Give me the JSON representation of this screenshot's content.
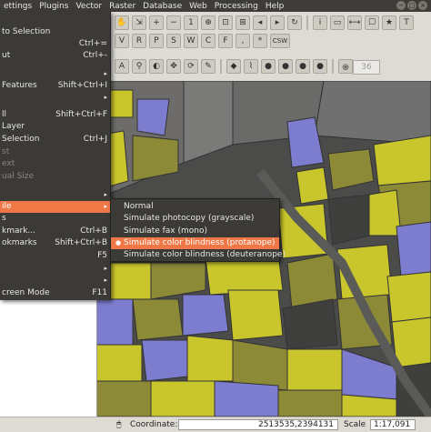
{
  "menubar": [
    "ettings",
    "Plugins",
    "Vector",
    "Raster",
    "Database",
    "Web",
    "Processing",
    "Help"
  ],
  "window_controls": [
    "−",
    "□",
    "×"
  ],
  "main_menu": [
    {
      "label": "to Selection",
      "shortcut": "",
      "state": "normal"
    },
    {
      "label": "",
      "shortcut": "Ctrl+=",
      "state": "normal"
    },
    {
      "label": "ut",
      "shortcut": "Ctrl+-",
      "state": "normal"
    },
    {
      "label": "",
      "shortcut": "▸",
      "state": "normal"
    },
    {
      "label": "Features",
      "shortcut": "Shift+Ctrl+I",
      "state": "normal"
    },
    {
      "label": "",
      "shortcut": "▸",
      "state": "normal"
    },
    {
      "label": "ll",
      "shortcut": "Shift+Ctrl+F",
      "state": "normal"
    },
    {
      "label": "Layer",
      "shortcut": "",
      "state": "normal"
    },
    {
      "label": "Selection",
      "shortcut": "Ctrl+J",
      "state": "normal"
    },
    {
      "label": "st",
      "shortcut": "",
      "state": "disabled"
    },
    {
      "label": "ext",
      "shortcut": "",
      "state": "disabled"
    },
    {
      "label": "ual Size",
      "shortcut": "",
      "state": "disabled"
    },
    {
      "label": "",
      "shortcut": "▸",
      "state": "normal"
    },
    {
      "label": "ile",
      "shortcut": "▸",
      "state": "active"
    },
    {
      "label": "s",
      "shortcut": "",
      "state": "normal"
    },
    {
      "label": "kmark...",
      "shortcut": "Ctrl+B",
      "state": "normal"
    },
    {
      "label": "okmarks",
      "shortcut": "Shift+Ctrl+B",
      "state": "normal"
    },
    {
      "label": "",
      "shortcut": "F5",
      "state": "normal"
    },
    {
      "label": "",
      "shortcut": "▸",
      "state": "normal"
    },
    {
      "label": "",
      "shortcut": "▸",
      "state": "normal"
    },
    {
      "label": "creen Mode",
      "shortcut": "F11",
      "state": "normal"
    }
  ],
  "submenu": [
    {
      "label": "Normal",
      "state": "normal"
    },
    {
      "label": "Simulate photocopy (grayscale)",
      "state": "normal"
    },
    {
      "label": "Simulate fax (mono)",
      "state": "normal"
    },
    {
      "label": "Simulate color blindness (protanope)",
      "state": "active"
    },
    {
      "label": "Simulate color blindness (deuteranope)",
      "state": "normal"
    }
  ],
  "toolbar": {
    "csw_label": "CSW",
    "scale_value": "36"
  },
  "status": {
    "coordinate_label": "Coordinate:",
    "coordinate_value": "2513535,2394131",
    "scale_label": "Scale",
    "scale_value": "1:17,091"
  },
  "colors": {
    "yellow": "#c9c52c",
    "olive": "#8c8a37",
    "purple": "#7d7dd0",
    "gray": "#6d6c6a",
    "dark": "#3f3f3d",
    "accent": "#f07746"
  }
}
